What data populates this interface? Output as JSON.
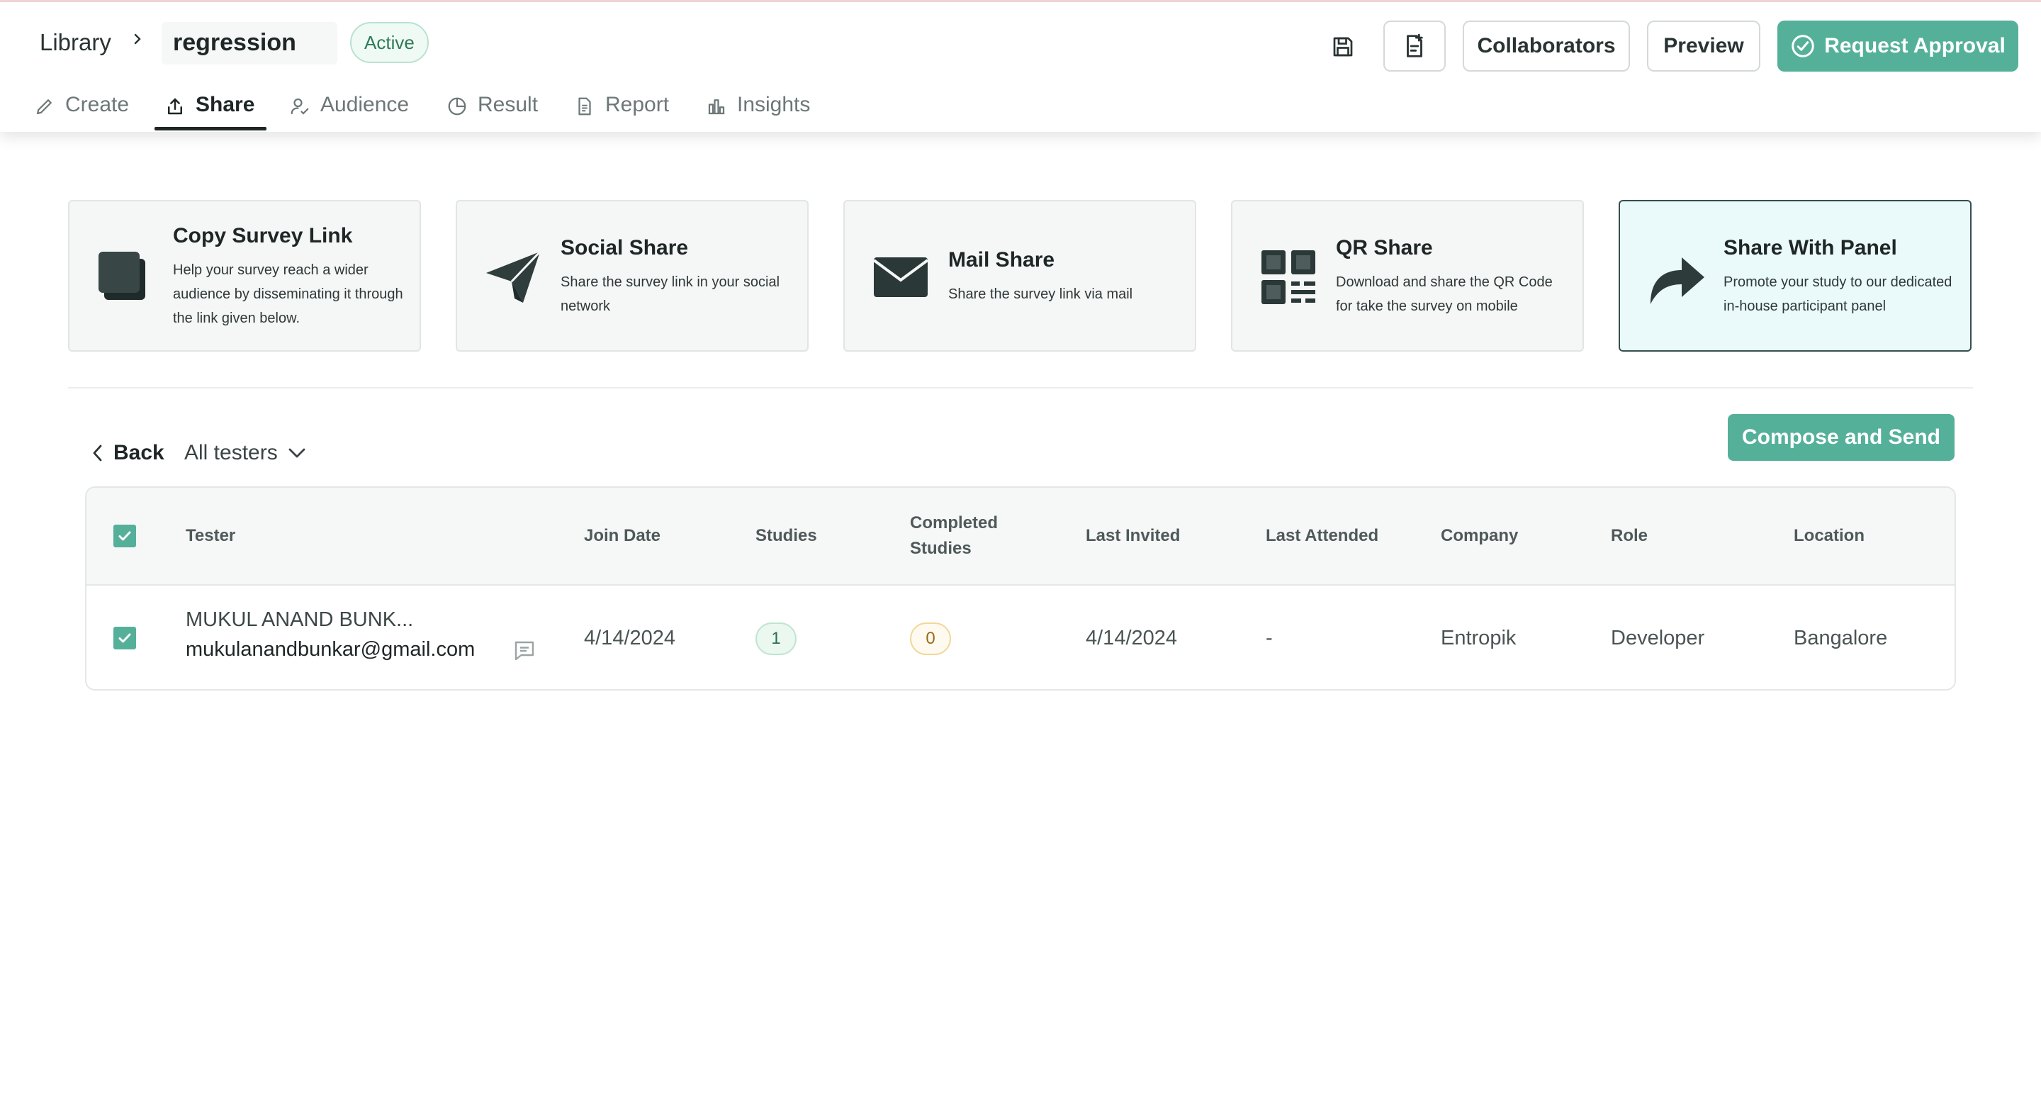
{
  "breadcrumb": {
    "library": "Library",
    "current": "regression"
  },
  "status": "Active",
  "header": {
    "save_icon": "save-icon",
    "copy_doc_icon": "document-add-icon",
    "collaborators": "Collaborators",
    "preview": "Preview",
    "request_approval": "Request Approval"
  },
  "tabs": [
    {
      "label": "Create",
      "icon": "pencil-icon"
    },
    {
      "label": "Share",
      "icon": "upload-icon",
      "active": true
    },
    {
      "label": "Audience",
      "icon": "users-icon"
    },
    {
      "label": "Result",
      "icon": "pie-chart-icon"
    },
    {
      "label": "Report",
      "icon": "document-icon"
    },
    {
      "label": "Insights",
      "icon": "bar-chart-icon"
    }
  ],
  "share_options": [
    {
      "title": "Copy Survey Link",
      "desc": "Help your survey reach a wider audience by disseminating it through the link given below.",
      "icon": "copy-icon"
    },
    {
      "title": "Social Share",
      "desc": "Share the survey link in your social network",
      "icon": "paper-plane-icon"
    },
    {
      "title": "Mail Share",
      "desc": "Share the survey link via mail",
      "icon": "envelope-icon"
    },
    {
      "title": "QR Share",
      "desc": "Download and share the QR Code for take the survey on mobile",
      "icon": "qr-code-icon"
    },
    {
      "title": "Share With Panel",
      "desc": "Promote your study to our dedicated in-house participant panel",
      "icon": "share-arrow-icon",
      "selected": true
    }
  ],
  "toolbar": {
    "back": "Back",
    "filter": "All testers",
    "compose": "Compose and Send"
  },
  "table": {
    "headers": {
      "tester": "Tester",
      "join_date": "Join Date",
      "studies": "Studies",
      "completed_line1": "Completed",
      "completed_line2": "Studies",
      "last_invited": "Last Invited",
      "last_attended": "Last Attended",
      "company": "Company",
      "role": "Role",
      "location": "Location"
    },
    "rows": [
      {
        "name": "MUKUL ANAND BUNK...",
        "email": "mukulanandbunkar@gmail.com",
        "join_date": "4/14/2024",
        "studies": "1",
        "completed": "0",
        "last_invited": "4/14/2024",
        "last_attended": "-",
        "company": "Entropik",
        "role": "Developer",
        "location": "Bangalore"
      }
    ]
  },
  "colors": {
    "accent": "#55b09a",
    "selected_card_bg": "#eafafa"
  }
}
